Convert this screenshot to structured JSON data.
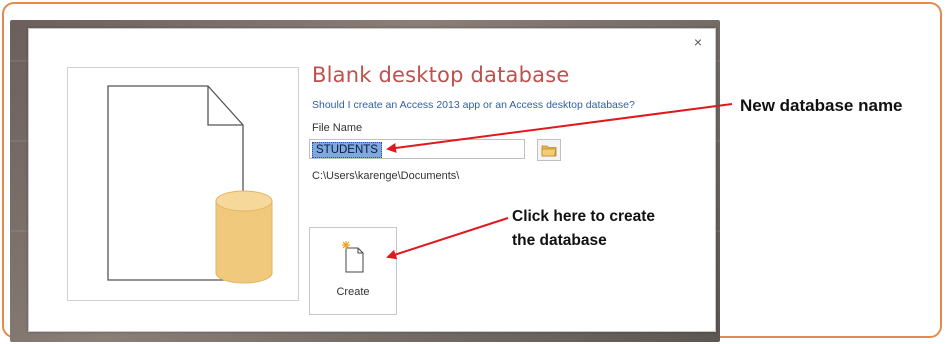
{
  "dialog": {
    "close_label": "×",
    "title": "Blank desktop database",
    "help_link": "Should I create an Access 2013 app or an Access desktop database?",
    "file_name_label": "File Name",
    "file_name_value": "STUDENTS",
    "path": "C:\\Users\\karenge\\Documents\\",
    "create_label": "Create",
    "browse_icon": "folder-icon",
    "create_icon": "new-file-sparkle-icon"
  },
  "annotations": {
    "name_callout": "New database name",
    "create_callout_line1": "Click here to create",
    "create_callout_line2": "the database"
  },
  "colors": {
    "title": "#c0504d",
    "link": "#2f5fa7",
    "arrow": "#e0191f",
    "cylinder": "#f0c97c",
    "frame": "#e58a4c"
  }
}
